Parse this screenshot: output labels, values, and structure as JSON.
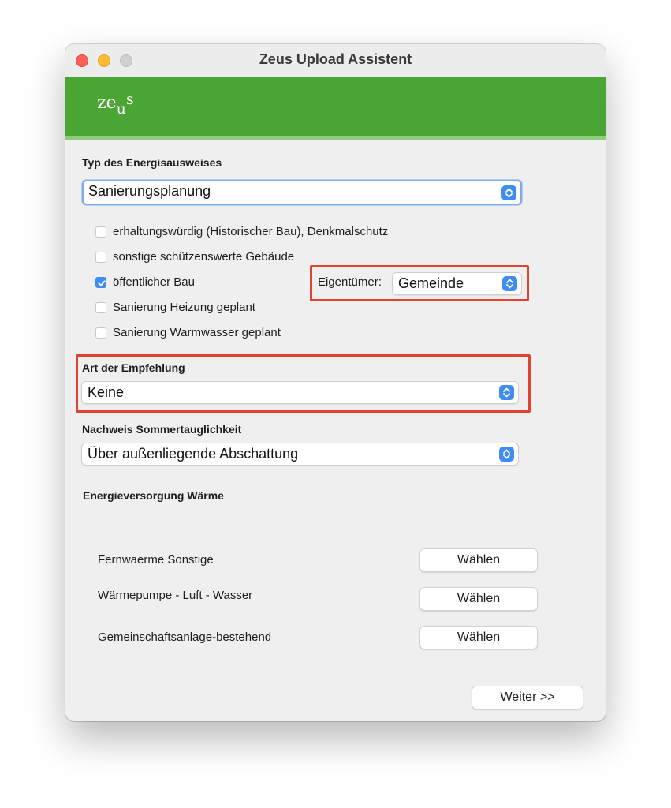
{
  "window": {
    "title": "Zeus Upload Assistent"
  },
  "banner": {
    "logo_main": "ze",
    "logo_sub": "u",
    "logo_sup": "s"
  },
  "type_section": {
    "label": "Typ des Energisausweises",
    "select_value": "Sanierungsplanung"
  },
  "checkboxes": [
    {
      "label": "erhaltungswürdig (Historischer Bau), Denkmalschutz",
      "checked": false
    },
    {
      "label": "sonstige schützenswerte Gebäude",
      "checked": false
    },
    {
      "label": "öffentlicher Bau",
      "checked": true
    },
    {
      "label": "Sanierung Heizung geplant",
      "checked": false
    },
    {
      "label": "Sanierung Warmwasser geplant",
      "checked": false
    }
  ],
  "owner": {
    "label": "Eigentümer:",
    "select_value": "Gemeinde"
  },
  "recommendation": {
    "label": "Art der Empfehlung",
    "select_value": "Keine"
  },
  "summer": {
    "label": "Nachweis Sommertauglichkeit",
    "select_value": "Über außenliegende Abschattung"
  },
  "energy": {
    "label": "Energieversorgung Wärme",
    "rows": [
      {
        "label": "Fernwaerme Sonstige",
        "button": "Wählen"
      },
      {
        "label": "Wärmepumpe - Luft - Wasser",
        "button": "Wählen"
      },
      {
        "label": "Gemeinschaftsanlage-bestehend",
        "button": "Wählen"
      }
    ]
  },
  "footer": {
    "next_button": "Weiter >>"
  },
  "colors": {
    "banner_green": "#4aa534",
    "accent_blue": "#3f8cf2",
    "highlight_red": "#e0442e",
    "traffic_close": "#fe5f57",
    "traffic_minimize": "#febc2e"
  },
  "icons": [
    "close-traffic-light",
    "minimize-traffic-light",
    "zoom-traffic-light",
    "stepper-chevrons-icon",
    "checkmark-icon"
  ]
}
